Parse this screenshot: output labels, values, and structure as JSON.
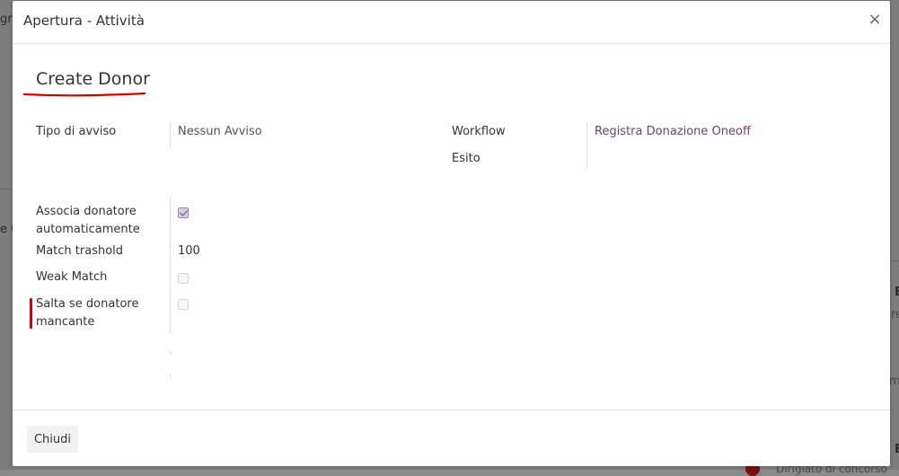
{
  "background": {
    "frag_left_1": "gr",
    "frag_left_2": "e C",
    "frag_right_1": "E",
    "frag_right_2": "re",
    "frag_right_3": "mit",
    "frag_right_4": "E",
    "frag_bottom": "Dirigiato di concorso"
  },
  "dialog": {
    "title": "Apertura - Attività",
    "record_title": "Create Donor",
    "fields": {
      "tipo_avviso_label": "Tipo di avviso",
      "tipo_avviso_value": "Nessun Avviso",
      "workflow_label": "Workflow",
      "workflow_value": "Registra Donazione Oneoff",
      "esito_label": "Esito",
      "associa_label": "Associa donatore automaticamente",
      "associa_checked": true,
      "match_label": "Match trashold",
      "match_value": "100",
      "weak_label": "Weak Match",
      "weak_checked": false,
      "salta_label": "Salta se donatore mancante",
      "salta_checked": false
    },
    "footer": {
      "close_label": "Chiudi"
    },
    "colors": {
      "link": "#71415e",
      "annotation": "#d00000"
    }
  }
}
